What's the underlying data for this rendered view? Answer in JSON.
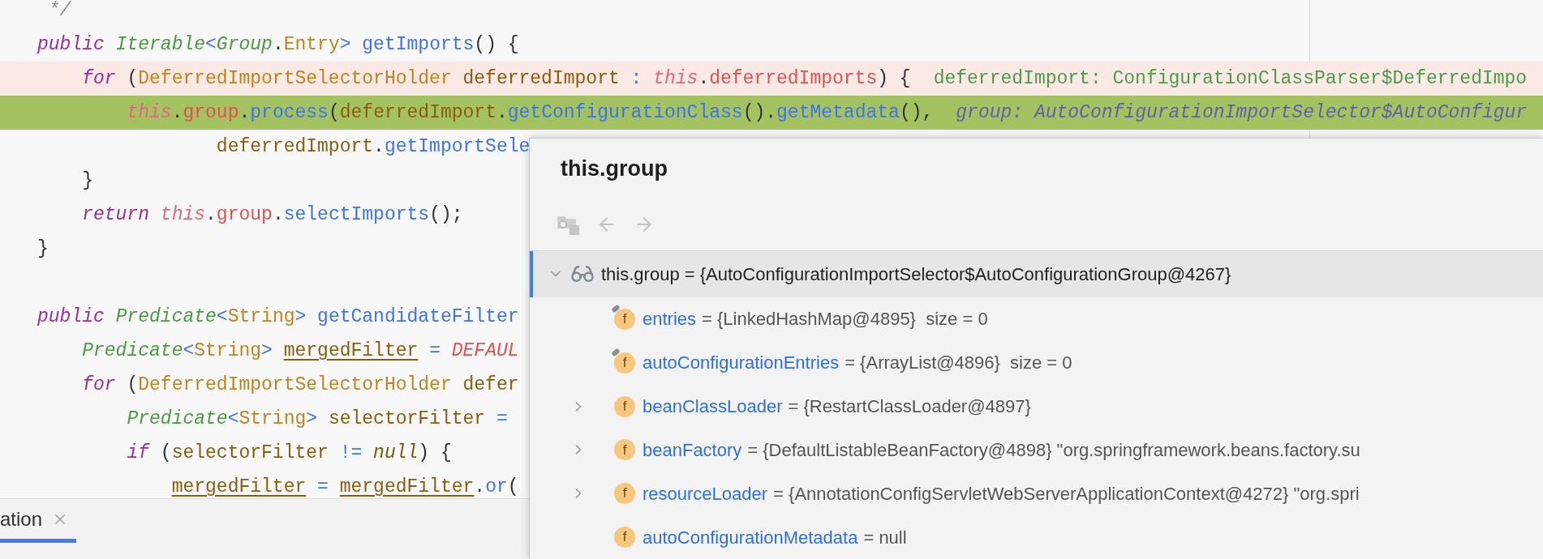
{
  "editor": {
    "lines": [
      {
        "kind": "plain",
        "tokens": [
          {
            "text": " */",
            "kind": "comment"
          }
        ]
      },
      {
        "kind": "plain",
        "tokens": [
          {
            "text": "public ",
            "kind": "keyword"
          },
          {
            "text": "Iterable",
            "kind": "type"
          },
          {
            "text": "<",
            "kind": "op"
          },
          {
            "text": "Group",
            "kind": "type"
          },
          {
            "text": ".",
            "kind": "plain"
          },
          {
            "text": "Entry",
            "kind": "class"
          },
          {
            "text": "> ",
            "kind": "op"
          },
          {
            "text": "getImports",
            "kind": "method"
          },
          {
            "text": "() {",
            "kind": "plain"
          }
        ]
      },
      {
        "kind": "breakpoint",
        "tokens": [
          {
            "text": "    for ",
            "kind": "keyword"
          },
          {
            "text": "(",
            "kind": "plain"
          },
          {
            "text": "DeferredImportSelectorHolder ",
            "kind": "class"
          },
          {
            "text": "deferredImport ",
            "kind": "var"
          },
          {
            "text": ": ",
            "kind": "op"
          },
          {
            "text": "this",
            "kind": "this"
          },
          {
            "text": ".",
            "kind": "plain"
          },
          {
            "text": "deferredImports",
            "kind": "field"
          },
          {
            "text": ") {",
            "kind": "plain"
          }
        ],
        "hint": {
          "text": "deferredImport: ConfigurationClassParser$DeferredImpo",
          "kind": "value"
        }
      },
      {
        "kind": "current",
        "tokens": [
          {
            "text": "        this",
            "kind": "this"
          },
          {
            "text": ".",
            "kind": "plain"
          },
          {
            "text": "group",
            "kind": "field"
          },
          {
            "text": ".",
            "kind": "plain"
          },
          {
            "text": "process",
            "kind": "method"
          },
          {
            "text": "(",
            "kind": "plain"
          },
          {
            "text": "deferredImport",
            "kind": "var"
          },
          {
            "text": ".",
            "kind": "plain"
          },
          {
            "text": "getConfigurationClass",
            "kind": "method"
          },
          {
            "text": "().",
            "kind": "plain"
          },
          {
            "text": "getMetadata",
            "kind": "method"
          },
          {
            "text": "(),",
            "kind": "plain"
          }
        ],
        "hint": {
          "text": "group: AutoConfigurationImportSelector$AutoConfigur",
          "kind": "field"
        }
      },
      {
        "kind": "plain",
        "tokens": [
          {
            "text": "                deferredImport",
            "kind": "var"
          },
          {
            "text": ".",
            "kind": "plain"
          },
          {
            "text": "getImportSele",
            "kind": "method"
          }
        ]
      },
      {
        "kind": "plain",
        "tokens": [
          {
            "text": "    }",
            "kind": "plain"
          }
        ]
      },
      {
        "kind": "plain",
        "tokens": [
          {
            "text": "    return ",
            "kind": "keyword"
          },
          {
            "text": "this",
            "kind": "this"
          },
          {
            "text": ".",
            "kind": "plain"
          },
          {
            "text": "group",
            "kind": "field"
          },
          {
            "text": ".",
            "kind": "plain"
          },
          {
            "text": "selectImports",
            "kind": "method"
          },
          {
            "text": "();",
            "kind": "plain"
          }
        ]
      },
      {
        "kind": "plain",
        "tokens": [
          {
            "text": "}",
            "kind": "plain"
          }
        ]
      },
      {
        "kind": "plain"
      },
      {
        "kind": "plain",
        "tokens": [
          {
            "text": "public ",
            "kind": "keyword"
          },
          {
            "text": "Predicate",
            "kind": "type"
          },
          {
            "text": "<",
            "kind": "op"
          },
          {
            "text": "String",
            "kind": "class"
          },
          {
            "text": "> ",
            "kind": "op"
          },
          {
            "text": "getCandidateFilter",
            "kind": "method"
          }
        ]
      },
      {
        "kind": "plain",
        "tokens": [
          {
            "text": "    Predicate",
            "kind": "type"
          },
          {
            "text": "<",
            "kind": "op"
          },
          {
            "text": "String",
            "kind": "class"
          },
          {
            "text": "> ",
            "kind": "op"
          },
          {
            "text": "mergedFilter",
            "kind": "reassigned"
          },
          {
            "text": " = ",
            "kind": "op"
          },
          {
            "text": "DEFAUL",
            "kind": "constant"
          }
        ]
      },
      {
        "kind": "plain",
        "tokens": [
          {
            "text": "    for ",
            "kind": "keyword"
          },
          {
            "text": "(",
            "kind": "plain"
          },
          {
            "text": "DeferredImportSelectorHolder ",
            "kind": "class"
          },
          {
            "text": "defer",
            "kind": "var"
          }
        ]
      },
      {
        "kind": "plain",
        "tokens": [
          {
            "text": "        Predicate",
            "kind": "type"
          },
          {
            "text": "<",
            "kind": "op"
          },
          {
            "text": "String",
            "kind": "class"
          },
          {
            "text": "> ",
            "kind": "op"
          },
          {
            "text": "selectorFilter ",
            "kind": "var"
          },
          {
            "text": "=",
            "kind": "op"
          }
        ]
      },
      {
        "kind": "plain",
        "tokens": [
          {
            "text": "        if ",
            "kind": "keyword"
          },
          {
            "text": "(",
            "kind": "plain"
          },
          {
            "text": "selectorFilter ",
            "kind": "var"
          },
          {
            "text": "!= ",
            "kind": "op"
          },
          {
            "text": "null",
            "kind": "literal"
          },
          {
            "text": ") {",
            "kind": "plain"
          }
        ]
      },
      {
        "kind": "plain",
        "tokens": [
          {
            "text": "            mergedFilter",
            "kind": "reassigned"
          },
          {
            "text": " = ",
            "kind": "op"
          },
          {
            "text": "mergedFilter",
            "kind": "reassigned"
          },
          {
            "text": ".",
            "kind": "plain"
          },
          {
            "text": "or",
            "kind": "method"
          },
          {
            "text": "(",
            "kind": "plain"
          }
        ]
      }
    ]
  },
  "bottom_tabs": [
    {
      "label": "ation",
      "selected": true
    }
  ],
  "popup": {
    "title": "this.group",
    "tree": {
      "text": "this.group = {AutoConfigurationImportSelector$AutoConfigurationGroup@4267}",
      "expanded": true,
      "selected": true,
      "children": [
        {
          "badge": "f",
          "marked": true,
          "expandable": false,
          "name": "entries",
          "value": "= {LinkedHashMap@4895}  size = 0"
        },
        {
          "badge": "f",
          "marked": true,
          "expandable": false,
          "name": "autoConfigurationEntries",
          "value": "= {ArrayList@4896}  size = 0"
        },
        {
          "badge": "f",
          "marked": false,
          "expandable": true,
          "name": "beanClassLoader",
          "value": "= {RestartClassLoader@4897}"
        },
        {
          "badge": "f",
          "marked": false,
          "expandable": true,
          "name": "beanFactory",
          "value": "= {DefaultListableBeanFactory@4898} \"org.springframework.beans.factory.su"
        },
        {
          "badge": "f",
          "marked": false,
          "expandable": true,
          "name": "resourceLoader",
          "value": "= {AnnotationConfigServletWebServerApplicationContext@4272} \"org.spri"
        },
        {
          "badge": "f",
          "marked": false,
          "expandable": false,
          "name": "autoConfigurationMetadata",
          "value": "= null"
        }
      ]
    }
  }
}
